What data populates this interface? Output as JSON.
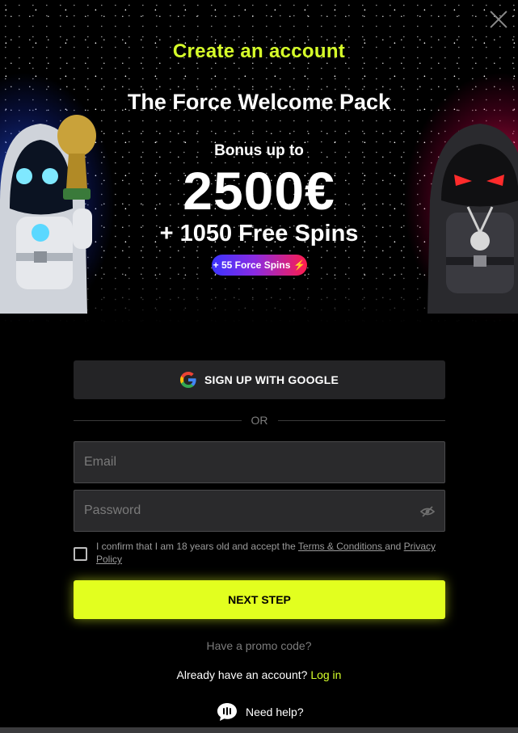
{
  "modal": {
    "close_icon": "close-icon"
  },
  "hero": {
    "heading": "Create an account",
    "pack_title": "The Force Welcome Pack",
    "bonus_prefix": "Bonus up to",
    "bonus_amount": "2500€",
    "free_spins": "+ 1050 Free Spins",
    "force_spins_badge": "+ 55 Force Spins",
    "badge_icon": "lightning-icon",
    "colors": {
      "accent": "#d6ff2a",
      "left_glow": "#2a5aff",
      "right_glow": "#ff145a"
    }
  },
  "form": {
    "google_button_label": "SIGN UP WITH GOOGLE",
    "divider_label": "OR",
    "email_placeholder": "Email",
    "password_placeholder": "Password",
    "password_toggle_icon": "eye-off-icon",
    "consent": {
      "prefix": "I confirm that I am 18 years old and accept the ",
      "terms_link": "Terms & Conditions ",
      "middle": "and ",
      "privacy_link": "Privacy Policy"
    },
    "next_button_label": "NEXT STEP",
    "next_button_color": "#e2ff1f",
    "promo_link": "Have a promo code?",
    "login_prompt": "Already have an account? ",
    "login_link": "Log in",
    "help_label": "Need help?",
    "help_icon": "chat-icon"
  }
}
